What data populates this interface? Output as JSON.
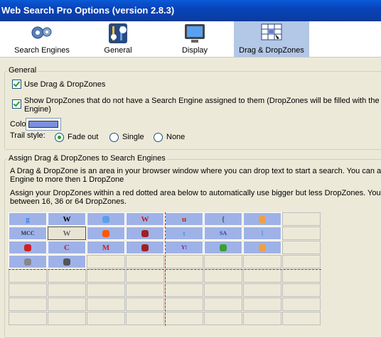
{
  "window": {
    "title": "Web Search Pro Options (version 2.8.3)"
  },
  "tabs": [
    {
      "label": "Search Engines",
      "icon": "gears-icon"
    },
    {
      "label": "General",
      "icon": "general-settings-icon"
    },
    {
      "label": "Display",
      "icon": "monitor-icon"
    },
    {
      "label": "Drag & DropZones",
      "icon": "dropzone-grid-icon",
      "active": true
    }
  ],
  "general": {
    "title": "General",
    "use_dnd": {
      "label": "Use Drag & DropZones",
      "checked": true
    },
    "show_dz": {
      "label_line1": "Show DropZones that do not have a Search Engine assigned to them (DropZones will be filled with the de",
      "label_line2": "Engine)",
      "checked": true
    },
    "color_label": "Color:",
    "color_value": "#7b8fde",
    "trail_label": "Trail style:",
    "trail_options": [
      "Fade out",
      "Single",
      "None"
    ],
    "trail_selected": "Fade out"
  },
  "assign": {
    "title": "Assign Drag & DropZones to Search Engines",
    "desc1_line1": "A Drag & DropZone is an area in your browser window where you can drop text to start a search. You can as",
    "desc1_line2": "Engine to more then 1 DropZone",
    "desc2_line1": "Assign your DropZones within a red dotted area below to automatically use bigger but less DropZones. You c",
    "desc2_line2": "between 16, 36 or 64 DropZones."
  },
  "grid": {
    "cells": [
      {
        "row": 0,
        "col": 0,
        "icon": "google-icon",
        "glyph": "g",
        "color": "#3b7be8"
      },
      {
        "row": 0,
        "col": 1,
        "icon": "wikipedia-icon",
        "glyph": "W",
        "color": "#000"
      },
      {
        "row": 0,
        "col": 2,
        "icon": "search-bird-icon",
        "glyph": "",
        "color": "#5aa0e8"
      },
      {
        "row": 0,
        "col": 3,
        "icon": "wikipedia-red-icon",
        "glyph": "W",
        "color": "#c02020"
      },
      {
        "row": 0,
        "col": 4,
        "icon": "u-icon",
        "glyph": "u",
        "color": "#b03000"
      },
      {
        "row": 0,
        "col": 5,
        "icon": "bracket-icon",
        "glyph": "{",
        "color": "#555"
      },
      {
        "row": 0,
        "col": 6,
        "icon": "orange-circle-icon",
        "glyph": "",
        "color": "#f0a040"
      },
      {
        "row": 1,
        "col": 0,
        "icon": "mcc-icon",
        "glyph": "MCC",
        "color": "#333"
      },
      {
        "row": 1,
        "col": 1,
        "icon": "wikipedia-icon",
        "glyph": "W",
        "color": "#666",
        "selected": true
      },
      {
        "row": 1,
        "col": 2,
        "icon": "reddit-icon",
        "glyph": "",
        "color": "#ff5700"
      },
      {
        "row": 1,
        "col": 3,
        "icon": "bookmark-icon",
        "glyph": "",
        "color": "#a02020"
      },
      {
        "row": 1,
        "col": 4,
        "icon": "twitter-icon",
        "glyph": "t",
        "color": "#40a0e0"
      },
      {
        "row": 1,
        "col": 5,
        "icon": "sa-icon",
        "glyph": "SA",
        "color": "#1a4aa0"
      },
      {
        "row": 1,
        "col": 6,
        "icon": "l-icon",
        "glyph": "l",
        "color": "#5aa0e8"
      },
      {
        "row": 2,
        "col": 0,
        "icon": "pony-icon",
        "glyph": "",
        "color": "#d02020"
      },
      {
        "row": 2,
        "col": 1,
        "icon": "c-icon",
        "glyph": "C",
        "color": "#c02020"
      },
      {
        "row": 2,
        "col": 2,
        "icon": "gmail-icon",
        "glyph": "M",
        "color": "#d02020"
      },
      {
        "row": 2,
        "col": 3,
        "icon": "bookmark-icon",
        "glyph": "",
        "color": "#a02020"
      },
      {
        "row": 2,
        "col": 4,
        "icon": "yahoo-icon",
        "glyph": "Y!",
        "color": "#7a1fa0"
      },
      {
        "row": 2,
        "col": 5,
        "icon": "swirl-icon",
        "glyph": "",
        "color": "#3aa030"
      },
      {
        "row": 2,
        "col": 6,
        "icon": "dots-icon",
        "glyph": "",
        "color": "#f0a040"
      },
      {
        "row": 3,
        "col": 0,
        "icon": "grid-icon",
        "glyph": "",
        "color": "#888"
      },
      {
        "row": 3,
        "col": 1,
        "icon": "people-icon",
        "glyph": "",
        "color": "#555"
      }
    ]
  }
}
